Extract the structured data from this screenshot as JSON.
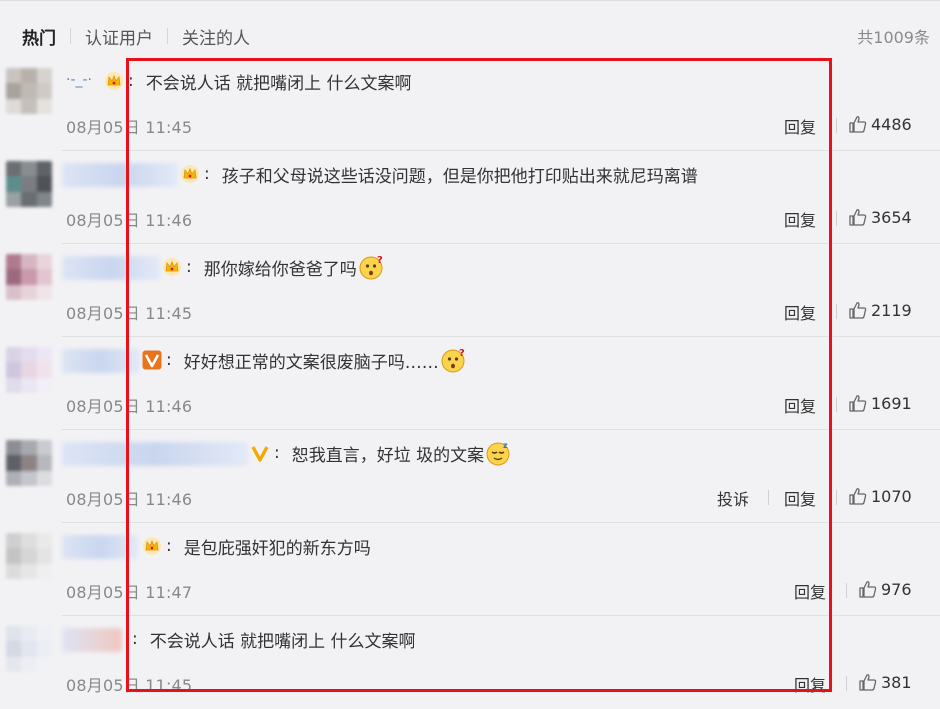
{
  "tabs": [
    {
      "label": "热门",
      "active": true
    },
    {
      "label": "认证用户",
      "active": false
    },
    {
      "label": "关注的人",
      "active": false
    }
  ],
  "total_count": "共1009条",
  "comments": [
    {
      "nick": "·-_-·",
      "badge": "crown",
      "text": "不会说人话 就把嘴闭上 什么文案啊",
      "emoji": null,
      "time": "08月05日 11:45",
      "actions": [
        "回复"
      ],
      "likes": "4486"
    },
    {
      "nick": "",
      "badge": "crown",
      "text": "孩子和父母说这些话没问题，但是你把他打印贴出来就尼玛离谱",
      "emoji": null,
      "time": "08月05日 11:46",
      "actions": [
        "回复"
      ],
      "likes": "3654"
    },
    {
      "nick": "",
      "badge": "crown",
      "text": "那你嫁给你爸爸了吗",
      "emoji": "confused-emoji",
      "time": "08月05日 11:45",
      "actions": [
        "回复"
      ],
      "likes": "2119"
    },
    {
      "nick": "",
      "badge": "vip-v",
      "text": "好好想正常的文案很废脑子吗……",
      "emoji": "confused-emoji",
      "time": "08月05日 11:46",
      "actions": [
        "回复"
      ],
      "likes": "1691"
    },
    {
      "nick": "",
      "badge": "verified-v",
      "text": "恕我直言，好垃 圾的文案",
      "emoji": "sleepy-emoji",
      "time": "08月05日 11:46",
      "actions": [
        "投诉",
        "回复"
      ],
      "likes": "1070"
    },
    {
      "nick": "",
      "badge": "crown",
      "text": "是包庇强奸犯的新东方吗",
      "emoji": null,
      "time": "08月05日 11:47",
      "actions": [
        "回复"
      ],
      "likes": "976"
    },
    {
      "nick": "",
      "badge": null,
      "text": "不会说人话 就把嘴闭上 什么文案啊",
      "emoji": null,
      "time": "08月05日 11:45",
      "actions": [
        "回复"
      ],
      "likes": "381"
    }
  ],
  "colors": {
    "highlight_box": "#e8101a",
    "nick": "#5b84c8",
    "crown": "#f5b800",
    "vip": "#e8741c"
  }
}
